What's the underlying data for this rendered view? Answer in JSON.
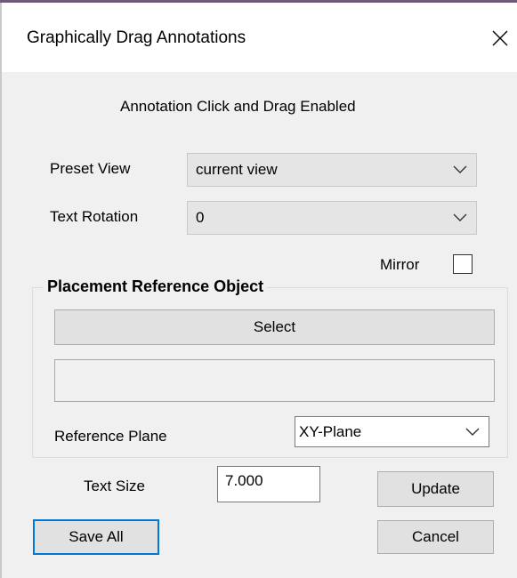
{
  "window": {
    "title": "Graphically Drag Annotations"
  },
  "status": {
    "message": "Annotation Click and Drag Enabled"
  },
  "preset_view": {
    "label": "Preset View",
    "value": "current view"
  },
  "text_rotation": {
    "label": "Text Rotation",
    "value": "0"
  },
  "mirror": {
    "label": "Mirror",
    "checked": false
  },
  "placement": {
    "group_label": "Placement Reference Object",
    "select_label": "Select",
    "selected_object": "",
    "reference_plane_label": "Reference Plane",
    "reference_plane_value": "XY-Plane"
  },
  "text_size": {
    "label": "Text Size",
    "value": "7.000"
  },
  "buttons": {
    "update": "Update",
    "save_all": "Save All",
    "cancel": "Cancel"
  },
  "colors": {
    "focus_border": "#0078d7",
    "client_bg": "#f0f0f0",
    "button_bg": "#e1e1e1"
  }
}
